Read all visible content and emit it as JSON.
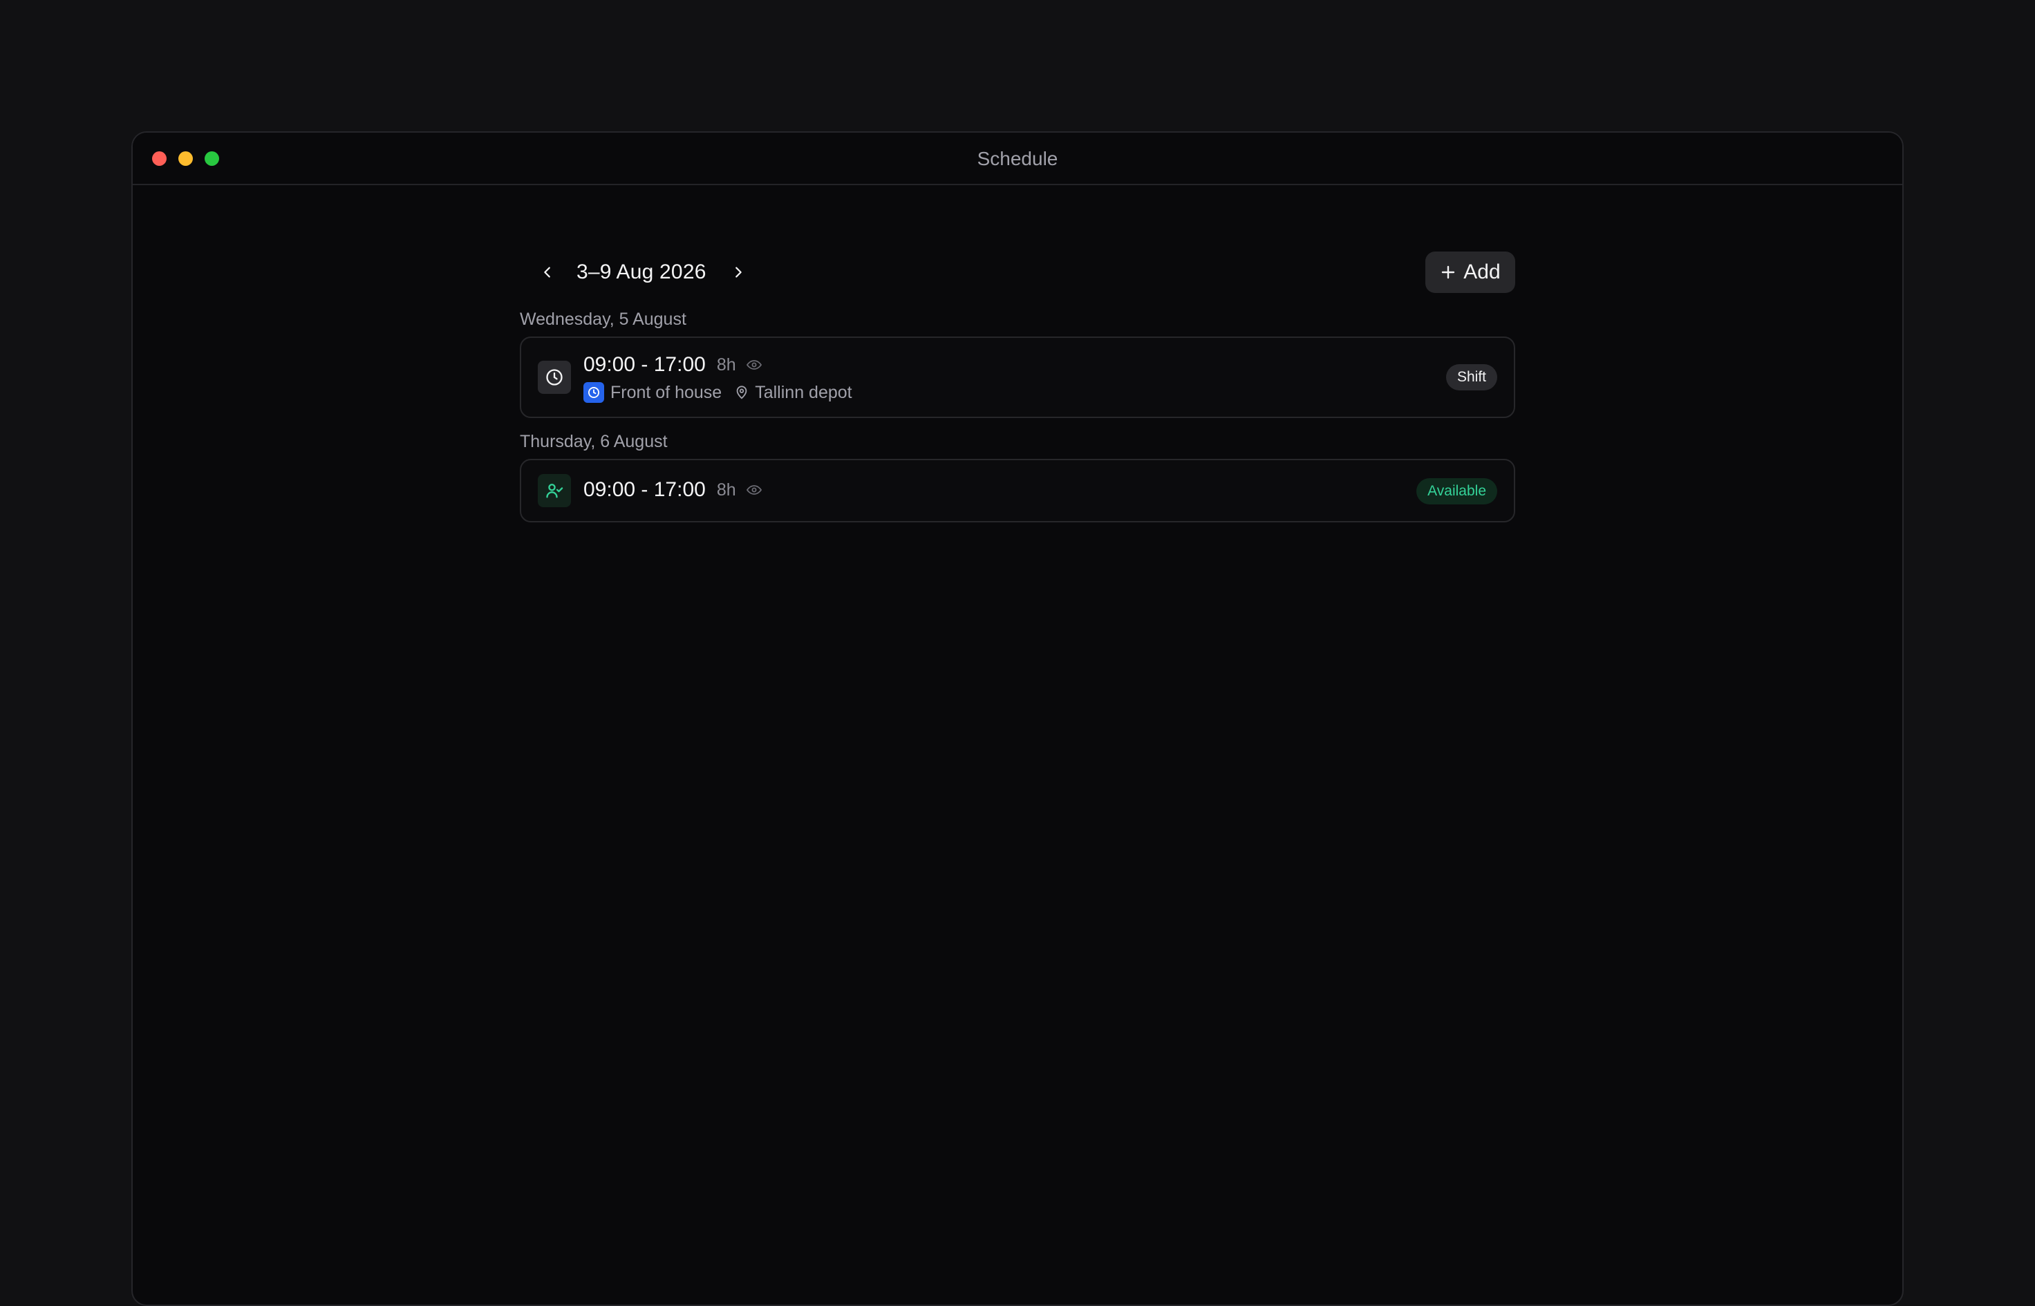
{
  "window": {
    "title": "Schedule"
  },
  "toolbar": {
    "range_label": "3–9 Aug 2026",
    "add_label": "Add"
  },
  "days": [
    {
      "label": "Wednesday, 5 August",
      "entry": {
        "time": "09:00 - 17:00",
        "duration": "8h",
        "role": "Front of house",
        "location": "Tallinn depot",
        "badge": "Shift",
        "icon": "clock-icon"
      }
    },
    {
      "label": "Thursday, 6 August",
      "entry": {
        "time": "09:00 - 17:00",
        "duration": "8h",
        "badge": "Available",
        "icon": "user-check-icon"
      }
    }
  ],
  "colors": {
    "available_accent": "#34d399",
    "role_color": "#2563eb"
  }
}
